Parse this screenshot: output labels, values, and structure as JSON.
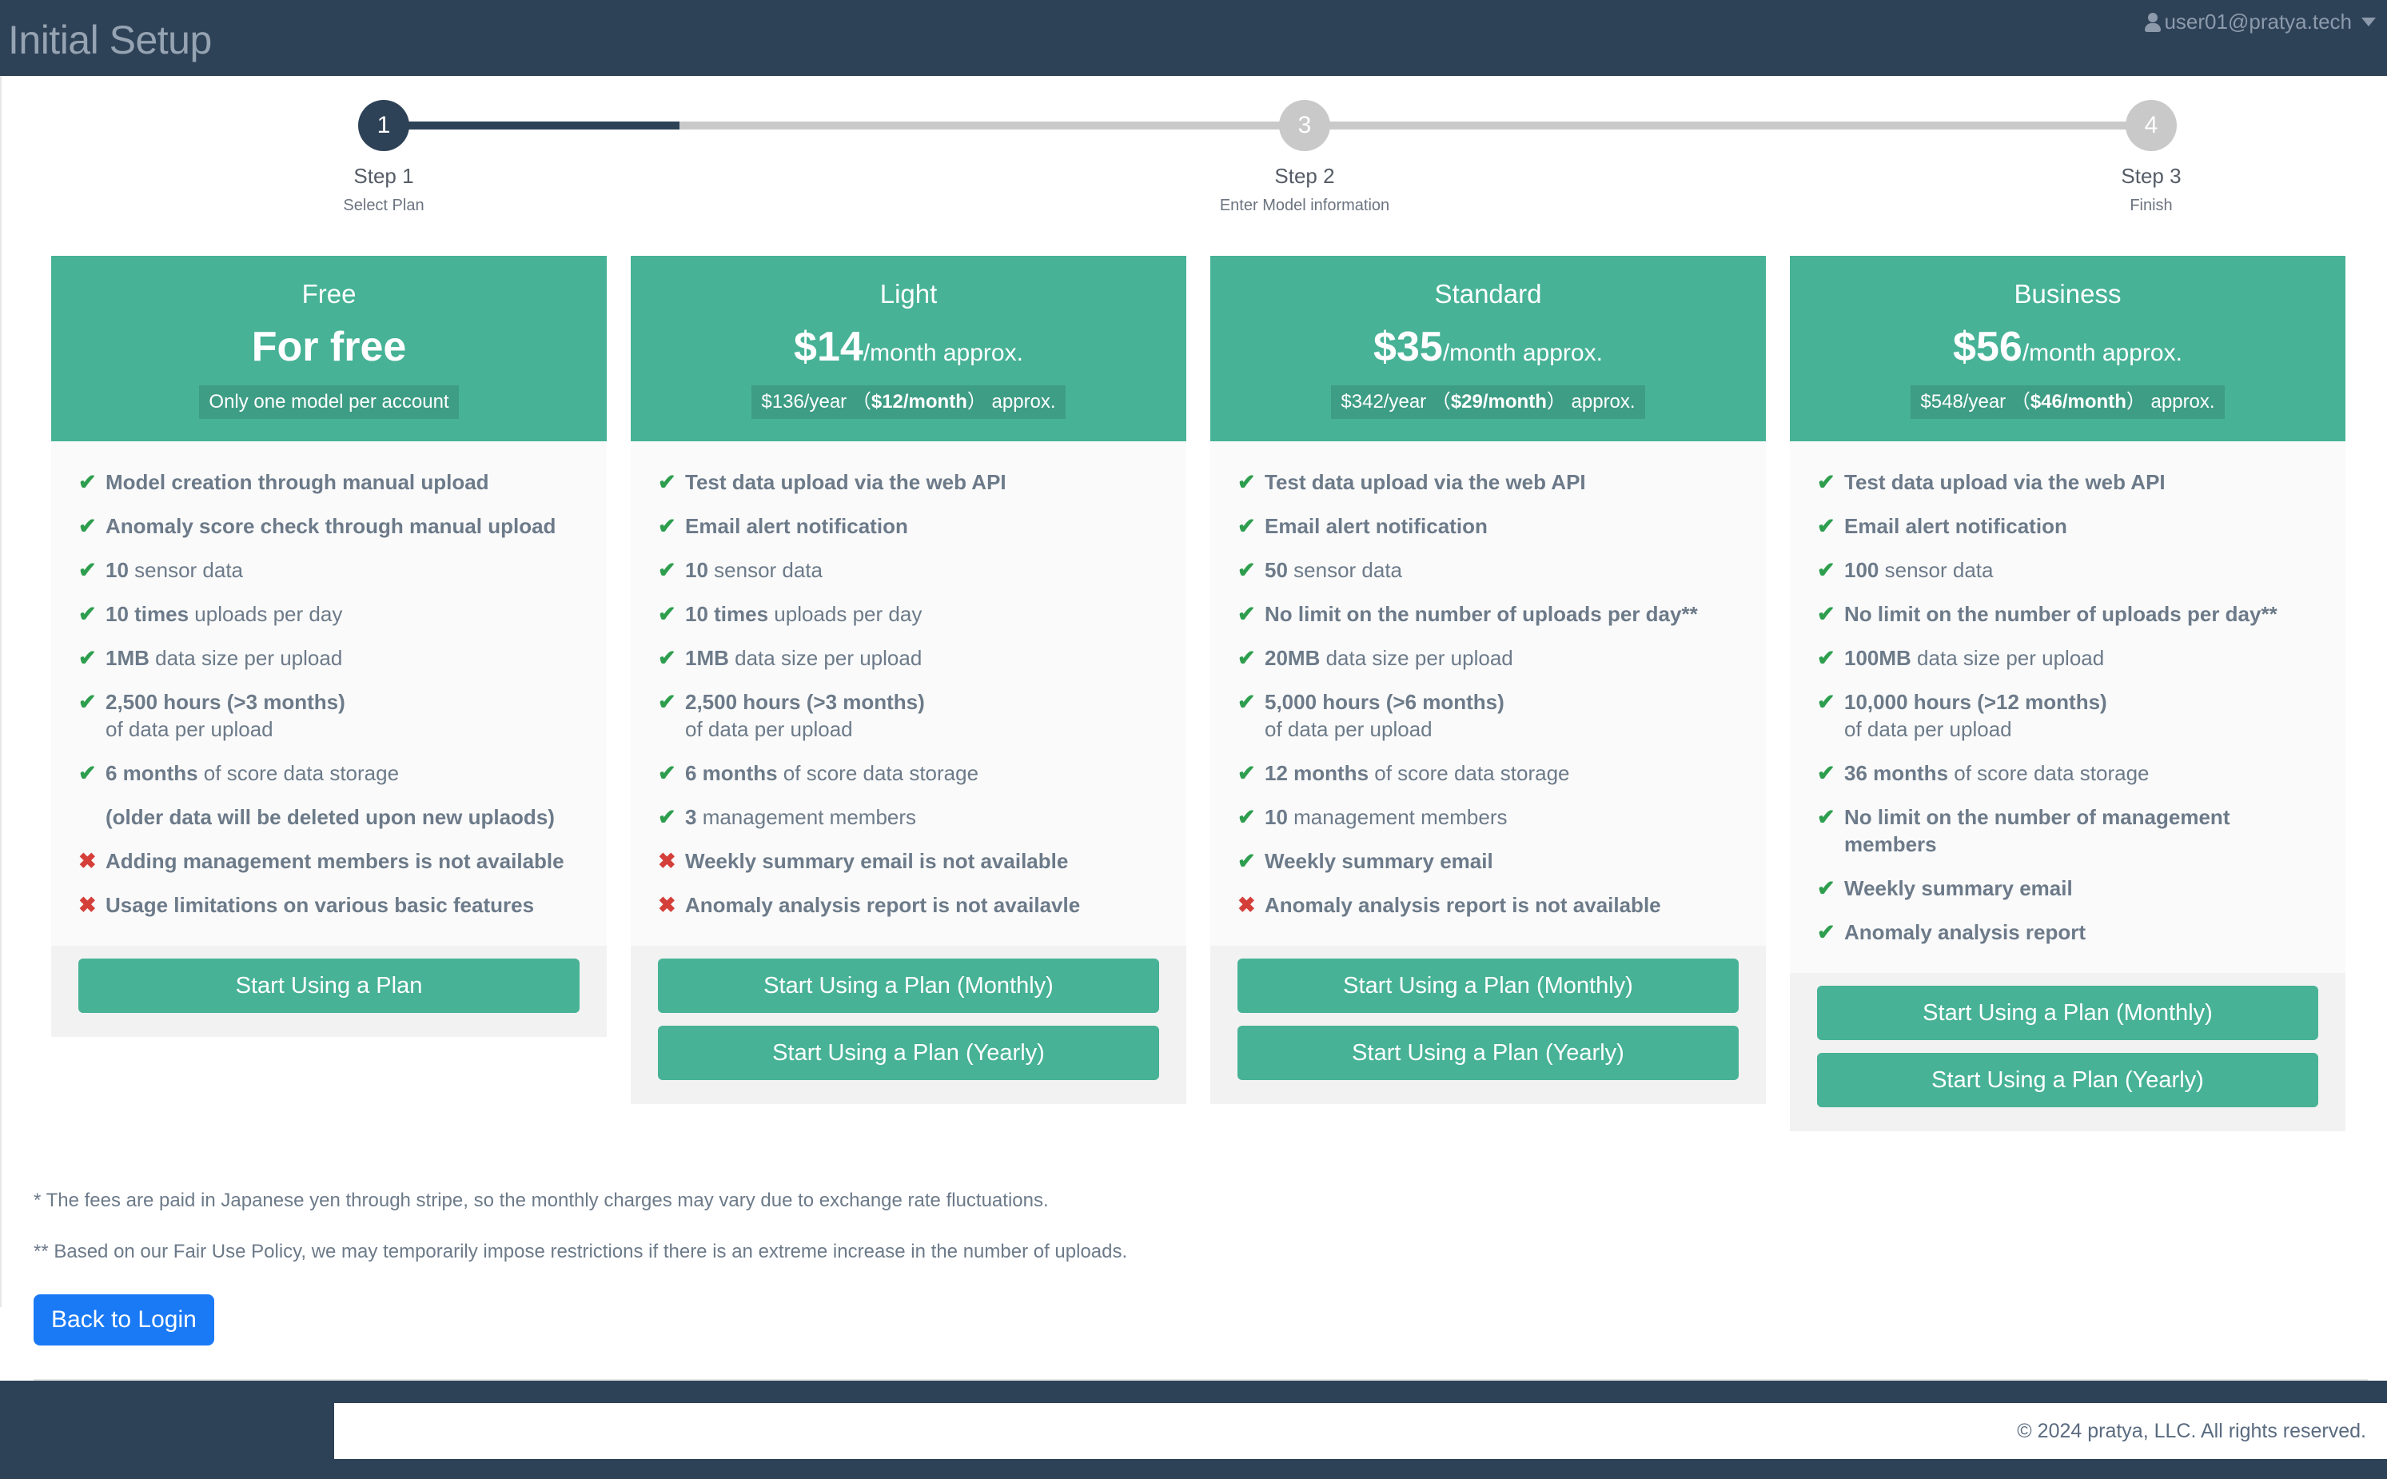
{
  "topbar": {
    "title": "Initial Setup",
    "user_email": "user01@pratya.tech",
    "user_icon": "user-icon",
    "caret_icon": "chevron-down-icon"
  },
  "stepper": {
    "steps": [
      {
        "number": "1",
        "label": "Step 1",
        "sublabel": "Select Plan",
        "state": "active"
      },
      {
        "number": "3",
        "label": "Step 2",
        "sublabel": "Enter Model information",
        "state": "inactive"
      },
      {
        "number": "4",
        "label": "Step 3",
        "sublabel": "Finish",
        "state": "inactive"
      }
    ]
  },
  "colors": {
    "header_dark": "#2e4257",
    "accent_teal": "#47b296",
    "badge_teal": "#3e9d85",
    "check_green": "#2e9e4e",
    "cross_red": "#d43f3a",
    "primary_blue": "#1a7af5"
  },
  "plans": [
    {
      "name": "Free",
      "price_amount": "For free",
      "price_suffix": "",
      "badge_pre": "Only one model per account",
      "badge_bold": "",
      "badge_post": "",
      "features": [
        {
          "mark": "yes",
          "bold": "Model creation through manual upload",
          "rest": "",
          "sub": ""
        },
        {
          "mark": "yes",
          "bold": "Anomaly score check through manual upload",
          "rest": "",
          "sub": ""
        },
        {
          "mark": "yes",
          "bold": "10",
          "rest": " sensor data",
          "sub": ""
        },
        {
          "mark": "yes",
          "bold": "10 times",
          "rest": " uploads per day",
          "sub": ""
        },
        {
          "mark": "yes",
          "bold": "1MB",
          "rest": " data size per upload",
          "sub": ""
        },
        {
          "mark": "yes",
          "bold": "2,500 hours  (>3 months)",
          "rest": "",
          "sub": "of data per upload"
        },
        {
          "mark": "yes",
          "bold": "6 months",
          "rest": " of score data storage",
          "sub": ""
        },
        {
          "mark": "none",
          "bold": "(older data will be deleted upon new uplaods)",
          "rest": "",
          "sub": ""
        },
        {
          "mark": "no",
          "bold": "Adding management members is not available",
          "rest": "",
          "sub": ""
        },
        {
          "mark": "no",
          "bold": "Usage limitations on various basic features",
          "rest": "",
          "sub": ""
        }
      ],
      "buttons": [
        "Start Using a Plan"
      ]
    },
    {
      "name": "Light",
      "price_amount": "$14",
      "price_suffix": "/month approx.",
      "badge_pre": "$136/year （",
      "badge_bold": "$12/month",
      "badge_post": "） approx.",
      "features": [
        {
          "mark": "yes",
          "bold": "Test data upload via the web API",
          "rest": "",
          "sub": ""
        },
        {
          "mark": "yes",
          "bold": "Email alert notification",
          "rest": "",
          "sub": ""
        },
        {
          "mark": "yes",
          "bold": "10",
          "rest": " sensor data",
          "sub": ""
        },
        {
          "mark": "yes",
          "bold": "10 times",
          "rest": " uploads per day",
          "sub": ""
        },
        {
          "mark": "yes",
          "bold": "1MB",
          "rest": " data size per upload",
          "sub": ""
        },
        {
          "mark": "yes",
          "bold": "2,500 hours  (>3 months)",
          "rest": "",
          "sub": "of data per upload"
        },
        {
          "mark": "yes",
          "bold": "6 months",
          "rest": " of score data storage",
          "sub": ""
        },
        {
          "mark": "yes",
          "bold": "3",
          "rest": " management members",
          "sub": ""
        },
        {
          "mark": "no",
          "bold": "Weekly summary email is not available",
          "rest": "",
          "sub": ""
        },
        {
          "mark": "no",
          "bold": "Anomaly analysis report is not availavle",
          "rest": "",
          "sub": ""
        }
      ],
      "buttons": [
        "Start Using a Plan (Monthly)",
        "Start Using a Plan (Yearly)"
      ]
    },
    {
      "name": "Standard",
      "price_amount": "$35",
      "price_suffix": "/month approx.",
      "badge_pre": "$342/year （",
      "badge_bold": "$29/month",
      "badge_post": "） approx.",
      "features": [
        {
          "mark": "yes",
          "bold": "Test data upload via the web API",
          "rest": "",
          "sub": ""
        },
        {
          "mark": "yes",
          "bold": "Email alert notification",
          "rest": "",
          "sub": ""
        },
        {
          "mark": "yes",
          "bold": "50",
          "rest": " sensor data",
          "sub": ""
        },
        {
          "mark": "yes",
          "bold": "No limit on the number of uploads per day**",
          "rest": "",
          "sub": ""
        },
        {
          "mark": "yes",
          "bold": "20MB",
          "rest": " data size per upload",
          "sub": ""
        },
        {
          "mark": "yes",
          "bold": "5,000 hours  (>6 months)",
          "rest": "",
          "sub": "of data per upload"
        },
        {
          "mark": "yes",
          "bold": "12 months",
          "rest": " of score data storage",
          "sub": ""
        },
        {
          "mark": "yes",
          "bold": "10",
          "rest": " management members",
          "sub": ""
        },
        {
          "mark": "yes",
          "bold": "Weekly summary email",
          "rest": "",
          "sub": ""
        },
        {
          "mark": "no",
          "bold": "Anomaly analysis report is not available",
          "rest": "",
          "sub": ""
        }
      ],
      "buttons": [
        "Start Using a Plan (Monthly)",
        "Start Using a Plan (Yearly)"
      ]
    },
    {
      "name": "Business",
      "price_amount": "$56",
      "price_suffix": "/month approx.",
      "badge_pre": "$548/year （",
      "badge_bold": "$46/month",
      "badge_post": "） approx.",
      "features": [
        {
          "mark": "yes",
          "bold": "Test data upload via the web API",
          "rest": "",
          "sub": ""
        },
        {
          "mark": "yes",
          "bold": "Email alert notification",
          "rest": "",
          "sub": ""
        },
        {
          "mark": "yes",
          "bold": "100",
          "rest": " sensor data",
          "sub": ""
        },
        {
          "mark": "yes",
          "bold": "No limit on the number of uploads per day**",
          "rest": "",
          "sub": ""
        },
        {
          "mark": "yes",
          "bold": "100MB",
          "rest": " data size per upload",
          "sub": ""
        },
        {
          "mark": "yes",
          "bold": "10,000 hours  (>12 months)",
          "rest": "",
          "sub": "of data per upload"
        },
        {
          "mark": "yes",
          "bold": "36 months",
          "rest": " of score data storage",
          "sub": ""
        },
        {
          "mark": "yes",
          "bold": "No limit on the number of management members",
          "rest": "",
          "sub": ""
        },
        {
          "mark": "yes",
          "bold": "Weekly summary email",
          "rest": "",
          "sub": ""
        },
        {
          "mark": "yes",
          "bold": "Anomaly analysis report",
          "rest": "",
          "sub": ""
        }
      ],
      "buttons": [
        "Start Using a Plan (Monthly)",
        "Start Using a Plan (Yearly)"
      ]
    }
  ],
  "notes": [
    "* The fees are paid in Japanese yen through stripe, so the monthly charges may vary due to exchange rate fluctuations.",
    "** Based on our Fair Use Policy, we may temporarily impose restrictions if there is an extreme increase in the number of uploads."
  ],
  "back_button": "Back to Login",
  "footer": {
    "copyright": "© 2024 pratya, LLC. All rights reserved."
  }
}
